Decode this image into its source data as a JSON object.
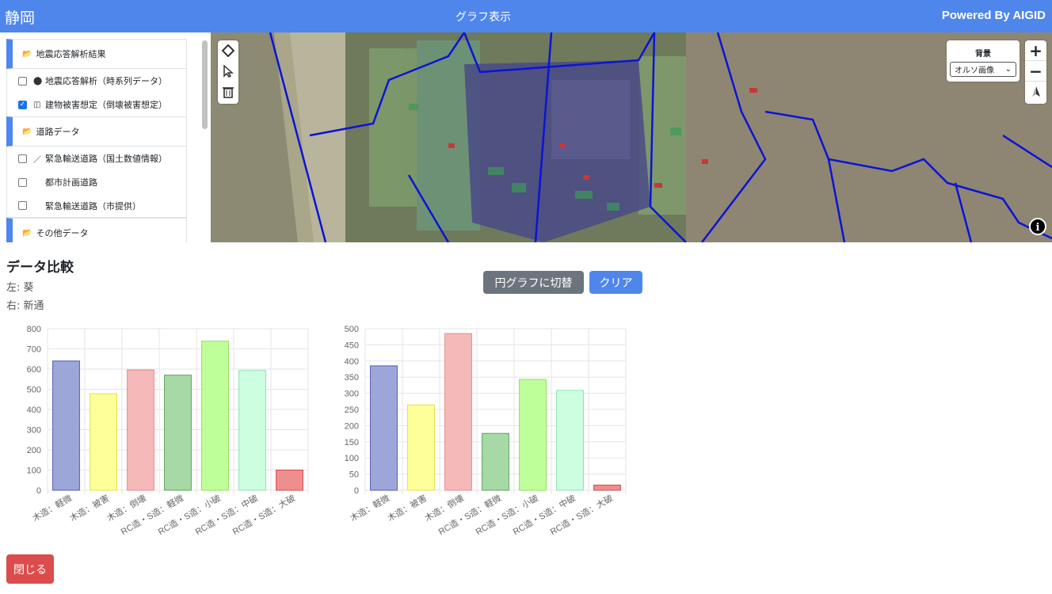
{
  "header": {
    "brand": "静岡",
    "title": "グラフ表示",
    "powered": "Powered By AIGID"
  },
  "sidebar": {
    "groups": [
      {
        "label": "地震応答解析結果",
        "items": [
          {
            "label": "地震応答解析（時系列データ）",
            "checked": false,
            "icon": "circle-icon"
          },
          {
            "label": "建物被害想定（倒壊被害想定）",
            "checked": true,
            "icon": "building-icon"
          }
        ]
      },
      {
        "label": "道路データ",
        "items": [
          {
            "label": "緊急輸送道路（国土数値情報）",
            "checked": false,
            "icon": "line-icon"
          },
          {
            "label": "都市計画道路",
            "checked": false,
            "icon": ""
          },
          {
            "label": "緊急輸送道路（市提供）",
            "checked": false,
            "icon": ""
          }
        ]
      },
      {
        "label": "その他データ",
        "items": []
      }
    ]
  },
  "map": {
    "background_label": "背景",
    "background_select": "オルソ画像",
    "zoom_in": "+",
    "zoom_out": "−",
    "info": "i"
  },
  "compare": {
    "title": "データ比較",
    "left_label": "左: 葵",
    "right_label": "右: 新通",
    "pie_button": "円グラフに切替",
    "clear_button": "クリア",
    "close_button": "閉じる"
  },
  "chart_data": [
    {
      "type": "bar",
      "categories": [
        "木造：軽微",
        "木造：被害",
        "木造：倒壊",
        "RC造・S造：軽微",
        "RC造・S造：小破",
        "RC造・S造：中破",
        "RC造・S造：大破"
      ],
      "values": [
        640,
        478,
        596,
        570,
        738,
        593,
        100
      ],
      "colors": [
        "#9ca6d9",
        "#ffff99",
        "#f6b9b9",
        "#a6d9a6",
        "#bfff99",
        "#ccffe0",
        "#ee8e8e"
      ],
      "borders": [
        "#4f5fb4",
        "#e0e04a",
        "#e88a8a",
        "#5fa45f",
        "#8de05a",
        "#8de0b4",
        "#d24a4a"
      ],
      "ylim": [
        0,
        800
      ],
      "yticks": [
        0,
        100,
        200,
        300,
        400,
        500,
        600,
        700,
        800
      ],
      "grid": true
    },
    {
      "type": "bar",
      "categories": [
        "木造：軽微",
        "木造：被害",
        "木造：倒壊",
        "RC造・S造：軽微",
        "RC造・S造：小破",
        "RC造・S造：中破",
        "RC造・S造：大破"
      ],
      "values": [
        385,
        264,
        485,
        176,
        343,
        309,
        16
      ],
      "colors": [
        "#9ca6d9",
        "#ffff99",
        "#f6b9b9",
        "#a6d9a6",
        "#bfff99",
        "#ccffe0",
        "#ee8e8e"
      ],
      "borders": [
        "#4f5fb4",
        "#e0e04a",
        "#e88a8a",
        "#5fa45f",
        "#8de05a",
        "#8de0b4",
        "#d24a4a"
      ],
      "ylim": [
        0,
        500
      ],
      "yticks": [
        0,
        50,
        100,
        150,
        200,
        250,
        300,
        350,
        400,
        450,
        500
      ],
      "grid": true
    }
  ]
}
